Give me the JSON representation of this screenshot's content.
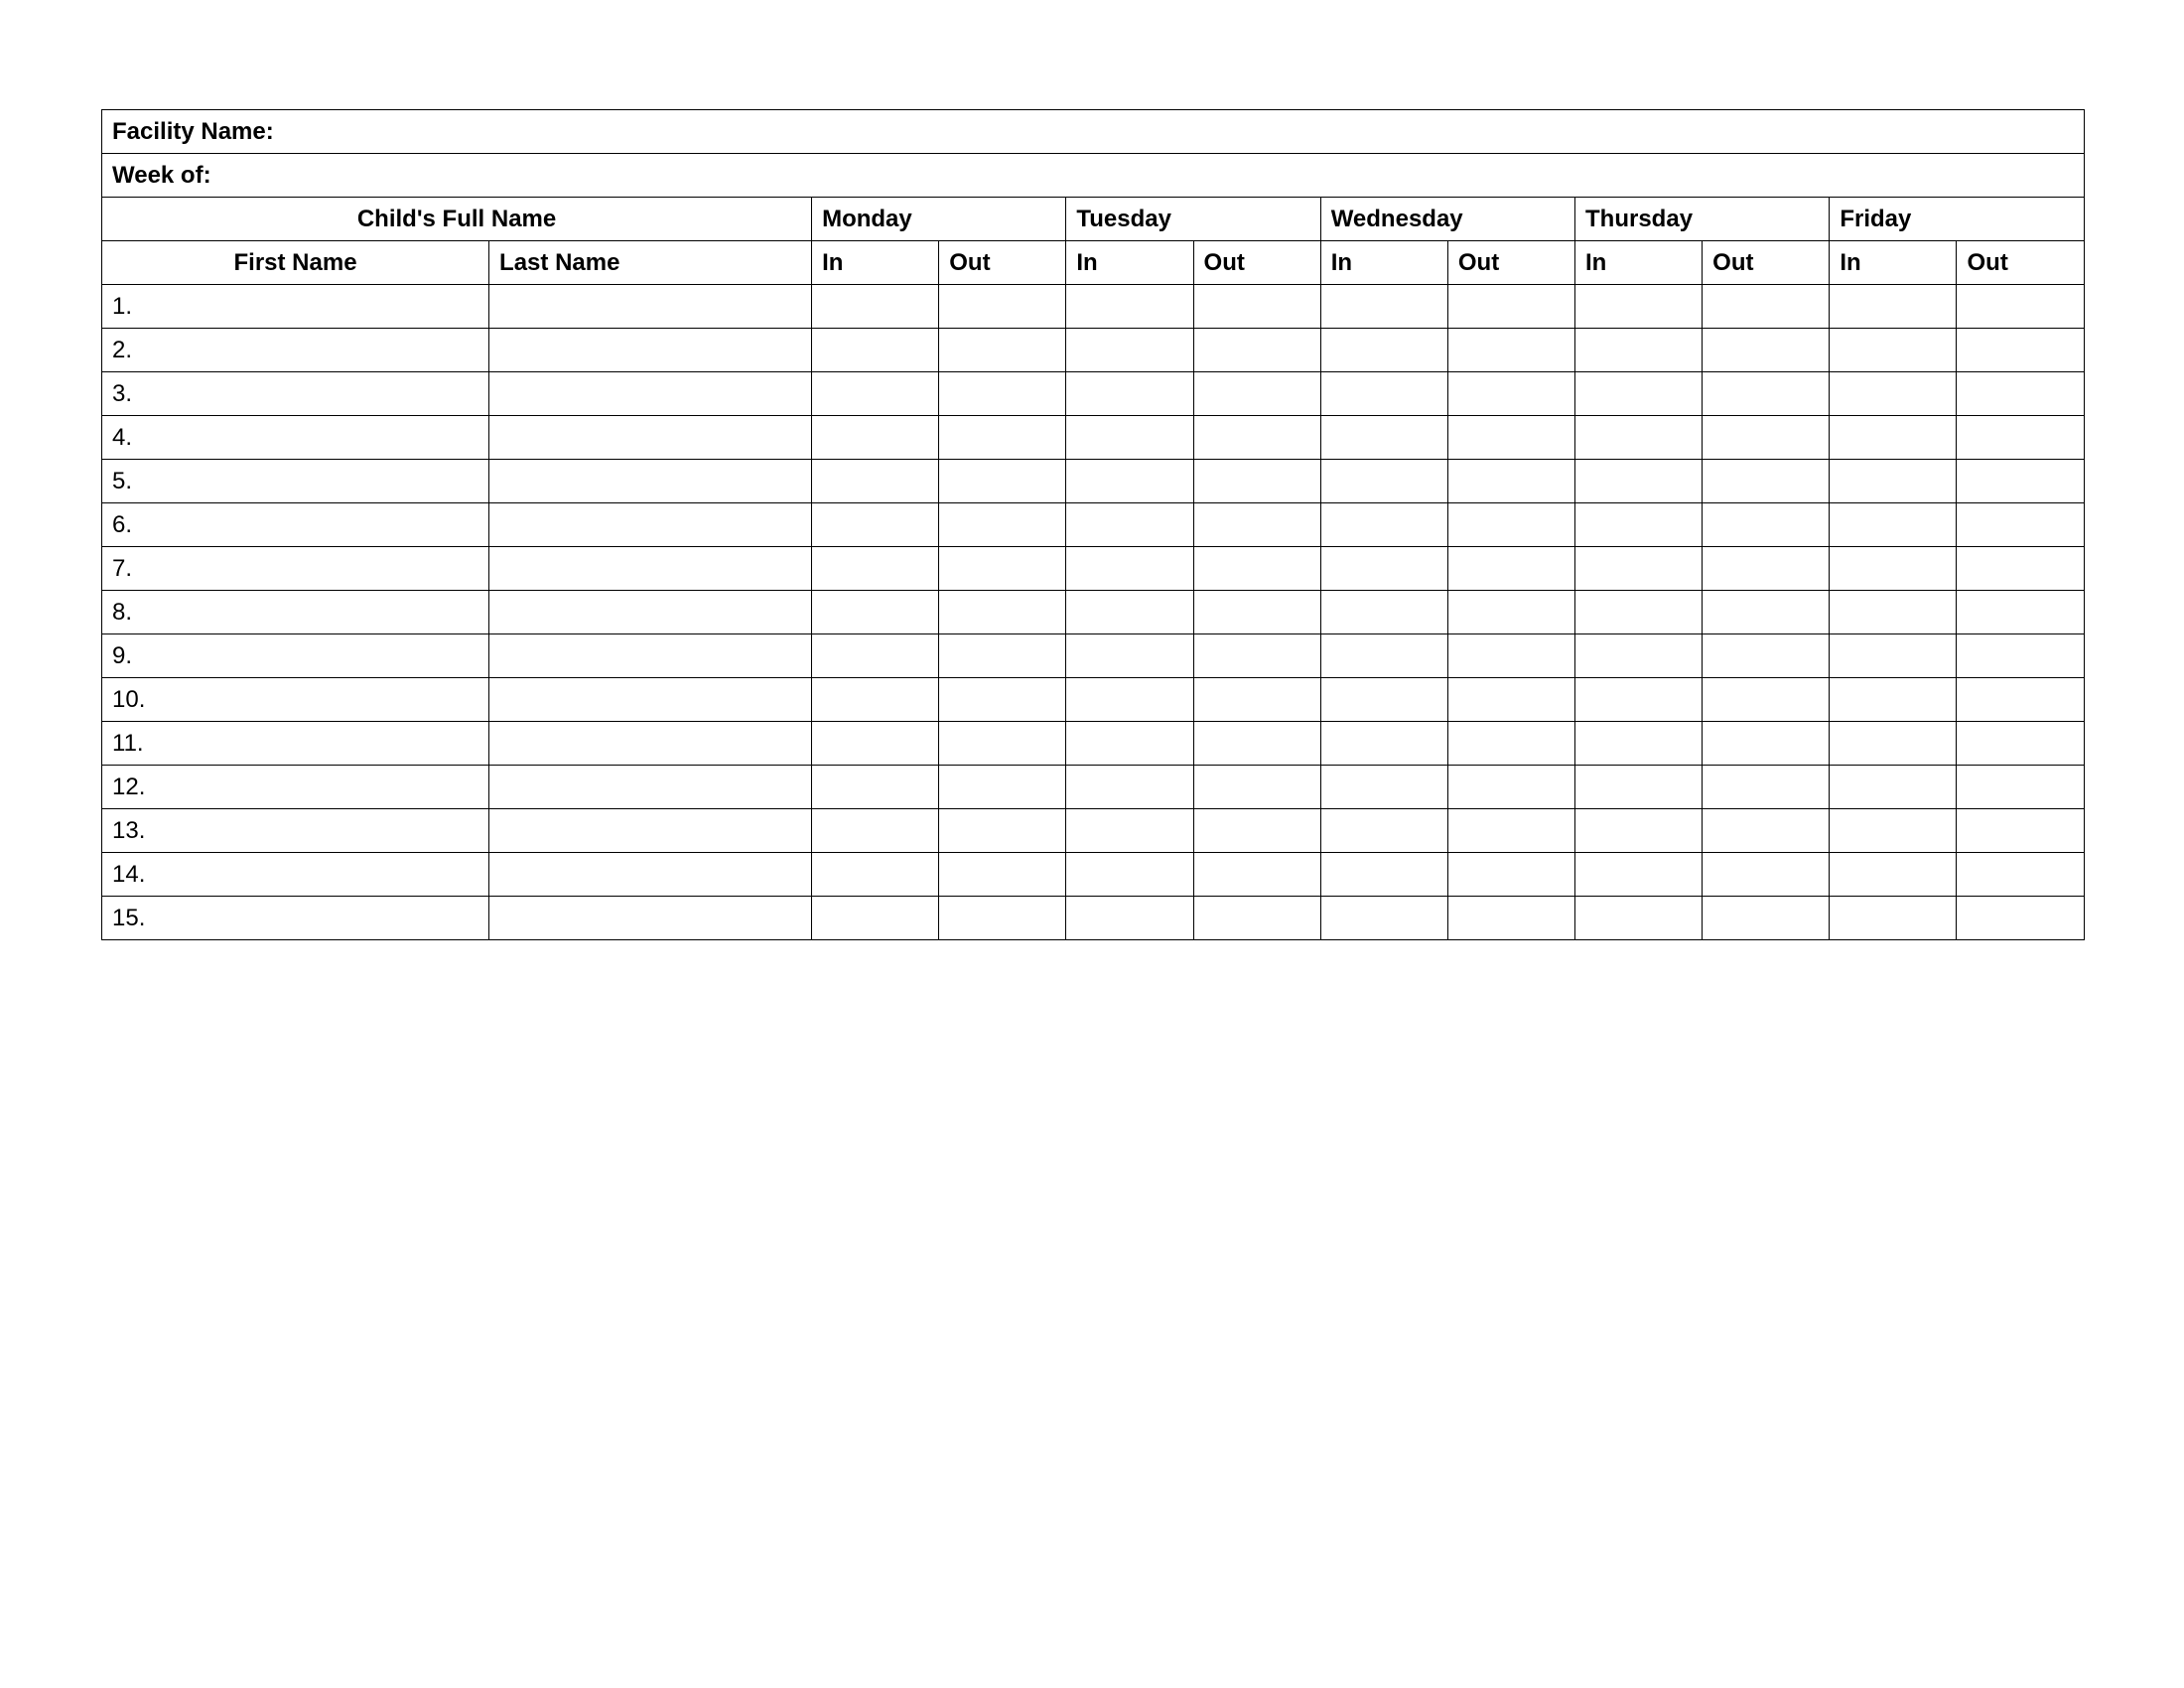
{
  "info": {
    "facility_label": "Facility Name:",
    "week_label": "Week of:"
  },
  "headers": {
    "child_full_name": "Child's Full Name",
    "first_name": "First Name",
    "last_name": "Last Name",
    "days": [
      "Monday",
      "Tuesday",
      "Wednesday",
      "Thursday",
      "Friday"
    ],
    "in": "In",
    "out": "Out"
  },
  "rows": [
    {
      "num": "1.",
      "first_name": "",
      "last_name": "",
      "mon_in": "",
      "mon_out": "",
      "tue_in": "",
      "tue_out": "",
      "wed_in": "",
      "wed_out": "",
      "thu_in": "",
      "thu_out": "",
      "fri_in": "",
      "fri_out": ""
    },
    {
      "num": "2.",
      "first_name": "",
      "last_name": "",
      "mon_in": "",
      "mon_out": "",
      "tue_in": "",
      "tue_out": "",
      "wed_in": "",
      "wed_out": "",
      "thu_in": "",
      "thu_out": "",
      "fri_in": "",
      "fri_out": ""
    },
    {
      "num": "3.",
      "first_name": "",
      "last_name": "",
      "mon_in": "",
      "mon_out": "",
      "tue_in": "",
      "tue_out": "",
      "wed_in": "",
      "wed_out": "",
      "thu_in": "",
      "thu_out": "",
      "fri_in": "",
      "fri_out": ""
    },
    {
      "num": "4.",
      "first_name": "",
      "last_name": "",
      "mon_in": "",
      "mon_out": "",
      "tue_in": "",
      "tue_out": "",
      "wed_in": "",
      "wed_out": "",
      "thu_in": "",
      "thu_out": "",
      "fri_in": "",
      "fri_out": ""
    },
    {
      "num": "5.",
      "first_name": "",
      "last_name": "",
      "mon_in": "",
      "mon_out": "",
      "tue_in": "",
      "tue_out": "",
      "wed_in": "",
      "wed_out": "",
      "thu_in": "",
      "thu_out": "",
      "fri_in": "",
      "fri_out": ""
    },
    {
      "num": "6.",
      "first_name": "",
      "last_name": "",
      "mon_in": "",
      "mon_out": "",
      "tue_in": "",
      "tue_out": "",
      "wed_in": "",
      "wed_out": "",
      "thu_in": "",
      "thu_out": "",
      "fri_in": "",
      "fri_out": ""
    },
    {
      "num": "7.",
      "first_name": "",
      "last_name": "",
      "mon_in": "",
      "mon_out": "",
      "tue_in": "",
      "tue_out": "",
      "wed_in": "",
      "wed_out": "",
      "thu_in": "",
      "thu_out": "",
      "fri_in": "",
      "fri_out": ""
    },
    {
      "num": "8.",
      "first_name": "",
      "last_name": "",
      "mon_in": "",
      "mon_out": "",
      "tue_in": "",
      "tue_out": "",
      "wed_in": "",
      "wed_out": "",
      "thu_in": "",
      "thu_out": "",
      "fri_in": "",
      "fri_out": ""
    },
    {
      "num": "9.",
      "first_name": "",
      "last_name": "",
      "mon_in": "",
      "mon_out": "",
      "tue_in": "",
      "tue_out": "",
      "wed_in": "",
      "wed_out": "",
      "thu_in": "",
      "thu_out": "",
      "fri_in": "",
      "fri_out": ""
    },
    {
      "num": "10.",
      "first_name": "",
      "last_name": "",
      "mon_in": "",
      "mon_out": "",
      "tue_in": "",
      "tue_out": "",
      "wed_in": "",
      "wed_out": "",
      "thu_in": "",
      "thu_out": "",
      "fri_in": "",
      "fri_out": ""
    },
    {
      "num": "11.",
      "first_name": "",
      "last_name": "",
      "mon_in": "",
      "mon_out": "",
      "tue_in": "",
      "tue_out": "",
      "wed_in": "",
      "wed_out": "",
      "thu_in": "",
      "thu_out": "",
      "fri_in": "",
      "fri_out": ""
    },
    {
      "num": "12.",
      "first_name": "",
      "last_name": "",
      "mon_in": "",
      "mon_out": "",
      "tue_in": "",
      "tue_out": "",
      "wed_in": "",
      "wed_out": "",
      "thu_in": "",
      "thu_out": "",
      "fri_in": "",
      "fri_out": ""
    },
    {
      "num": "13.",
      "first_name": "",
      "last_name": "",
      "mon_in": "",
      "mon_out": "",
      "tue_in": "",
      "tue_out": "",
      "wed_in": "",
      "wed_out": "",
      "thu_in": "",
      "thu_out": "",
      "fri_in": "",
      "fri_out": ""
    },
    {
      "num": "14.",
      "first_name": "",
      "last_name": "",
      "mon_in": "",
      "mon_out": "",
      "tue_in": "",
      "tue_out": "",
      "wed_in": "",
      "wed_out": "",
      "thu_in": "",
      "thu_out": "",
      "fri_in": "",
      "fri_out": ""
    },
    {
      "num": "15.",
      "first_name": "",
      "last_name": "",
      "mon_in": "",
      "mon_out": "",
      "tue_in": "",
      "tue_out": "",
      "wed_in": "",
      "wed_out": "",
      "thu_in": "",
      "thu_out": "",
      "fri_in": "",
      "fri_out": ""
    }
  ]
}
